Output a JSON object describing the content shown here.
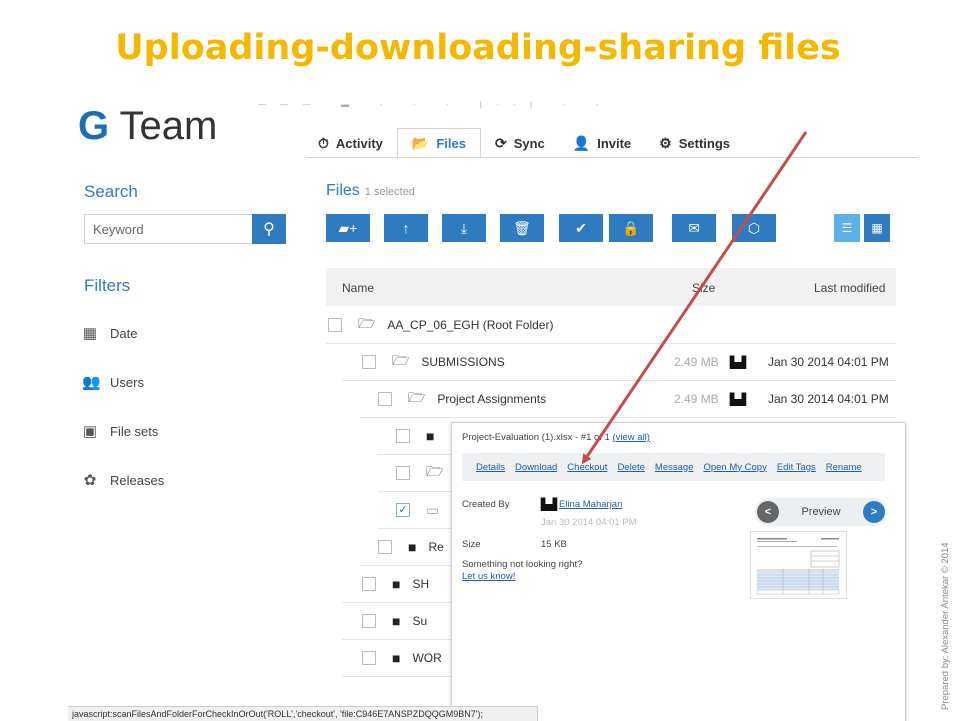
{
  "slide": {
    "title": "Uploading-downloading-sharing files",
    "credit": "Prepared by: Alexander Antekar © 2014"
  },
  "app": {
    "logo_g": "G",
    "logo_rest": "Team"
  },
  "nav": {
    "tabs": [
      {
        "label": "Activity",
        "icon": "clock-icon",
        "active": false
      },
      {
        "label": "Files",
        "icon": "folder-icon",
        "active": true
      },
      {
        "label": "Sync",
        "icon": "sync-icon",
        "active": false
      },
      {
        "label": "Invite",
        "icon": "add-user-icon",
        "active": false
      },
      {
        "label": "Settings",
        "icon": "gear-icon",
        "active": false
      }
    ]
  },
  "sidebar": {
    "search_title": "Search",
    "search_placeholder": "Keyword",
    "filters_title": "Filters",
    "filters": [
      {
        "label": "Date",
        "icon": "calendar-icon"
      },
      {
        "label": "Users",
        "icon": "users-icon"
      },
      {
        "label": "File sets",
        "icon": "file-sets-icon"
      },
      {
        "label": "Releases",
        "icon": "releases-icon"
      }
    ]
  },
  "files": {
    "title": "Files",
    "selected": "1 selected",
    "toolbar_icons": [
      "new-folder-icon",
      "upload-icon",
      "download-icon",
      "delete-icon",
      "checkmark-icon",
      "lock-icon",
      "email-icon",
      "share-icon"
    ],
    "view_icons": [
      "list-view-icon",
      "grid-view-icon"
    ],
    "columns": {
      "name": "Name",
      "size": "Size",
      "modified": "Last modified"
    },
    "rows": [
      {
        "name": "AA_CP_06_EGH (Root Folder)",
        "size": "",
        "modified": ""
      },
      {
        "name": "SUBMISSIONS",
        "size": "2.49 MB",
        "modified": "Jan 30 2014 04:01 PM"
      },
      {
        "name": "Project Assignments",
        "size": "2.49 MB",
        "modified": "Jan 30 2014 04:01 PM"
      },
      {
        "name": "",
        "size": "",
        "modified": ""
      },
      {
        "name": "",
        "size": "",
        "modified": ""
      },
      {
        "name": "",
        "size": "",
        "modified": ""
      },
      {
        "name": "Re",
        "size": "",
        "modified": ""
      },
      {
        "name": "SH",
        "size": "",
        "modified": ""
      },
      {
        "name": "Su",
        "size": "",
        "modified": ""
      },
      {
        "name": "WOR",
        "size": "",
        "modified": ""
      }
    ]
  },
  "popup": {
    "file_title": "Project-Evaluation (1).xlsx - #1 of 1",
    "view_all": "(view all)",
    "actions": [
      "Details",
      "Download",
      "Checkout",
      "Delete",
      "Message",
      "Open My Copy",
      "Edit Tags",
      "Rename"
    ],
    "created_by_label": "Created By",
    "created_by": "Elina Maharjan",
    "created_date": "Jan 30 2014 04:01 PM",
    "size_label": "Size",
    "size": "15 KB",
    "feedback": "Something not looking right?",
    "feedback_link": "Let us know!",
    "preview_label": "Preview",
    "preview_prev": "<",
    "preview_next": ">"
  },
  "statusbar": {
    "text": "javascript:scanFilesAndFolderForCheckInOrOut('ROLL','checkout', 'file:C946E7ANSPZDQQGM9BN7');"
  },
  "colors": {
    "title": "#f5b800",
    "accent": "#2e7bbf",
    "arrow": "#c0504d"
  }
}
